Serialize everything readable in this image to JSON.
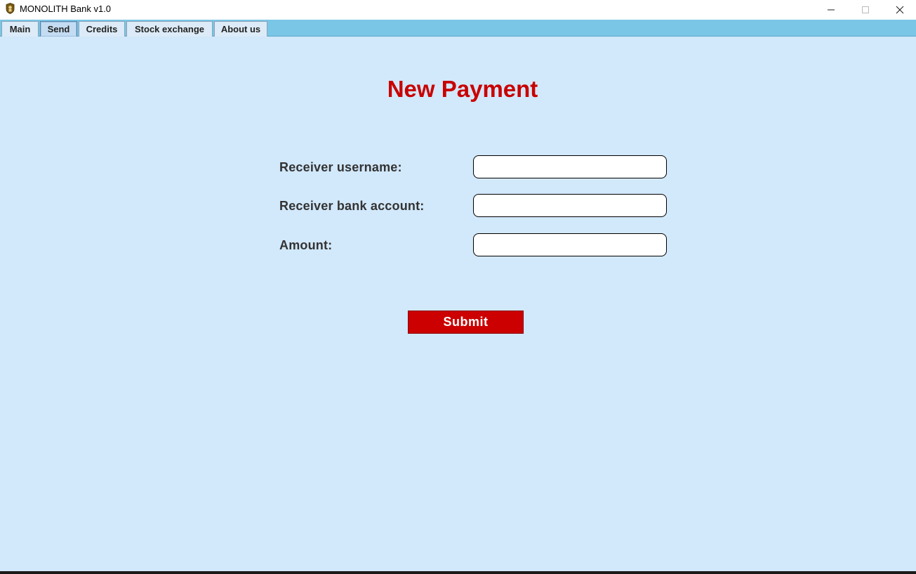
{
  "window": {
    "title": "MONOLITH Bank v1.0",
    "icon": "monolith-logo-icon"
  },
  "tabs": [
    {
      "label": "Main",
      "active": false
    },
    {
      "label": "Send",
      "active": true
    },
    {
      "label": "Credits",
      "active": false
    },
    {
      "label": "Stock exchange",
      "active": false
    },
    {
      "label": "About us",
      "active": false
    }
  ],
  "form": {
    "title": "New Payment",
    "receiver_username_label": "Receiver username:",
    "receiver_username_value": "",
    "receiver_account_label": "Receiver bank account:",
    "receiver_account_value": "",
    "amount_label": "Amount:",
    "amount_value": "",
    "submit_label": "Submit"
  },
  "colors": {
    "background": "#d2e8fb",
    "tabbar": "#7ac6e6",
    "title_red": "#c80000",
    "submit_red": "#cc0000"
  }
}
